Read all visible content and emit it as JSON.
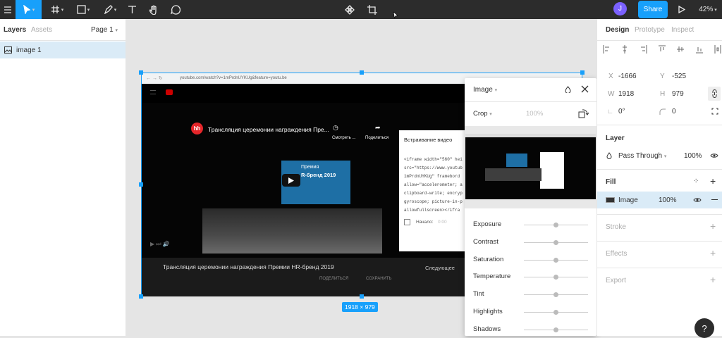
{
  "toolbar": {
    "avatar_initial": "J",
    "share_label": "Share",
    "zoom": "42%"
  },
  "left_panel": {
    "tab_layers": "Layers",
    "tab_assets": "Assets",
    "page_label": "Page 1",
    "layers": [
      {
        "label": "image 1"
      }
    ]
  },
  "canvas": {
    "dimension_badge": "1918 × 979",
    "browser_url": "youtube.com/watch?v=1mPrdnUYKUg&feature=youtu.be",
    "video": {
      "title": "Трансляция церемонии награждения Пре...",
      "watch_later": "Смотреть ...",
      "share": "Поделиться",
      "screen_line1": "Премия",
      "screen_line2": "R-бренд 2019",
      "below_title": "Трансляция церемонии награждения Премии HR-бренд 2019",
      "next_label": "Следующее",
      "share_action": "ПОДЕЛИТЬСЯ",
      "save_action": "СОХРАНИТЬ"
    },
    "embed": {
      "heading": "Встраивание видео",
      "code_lines": [
        "<iframe width=\"560\" hei",
        "src=\"https://www.youtub",
        "1mPrdnUYKUg\" framebord",
        "allow=\"accelerometer; a",
        "clipboard-write; encryp",
        "gyroscope; picture-in-p",
        "allowfullscreen></ifra"
      ],
      "start_label": "Начало:",
      "start_value": "0:00"
    }
  },
  "image_popover": {
    "title": "Image",
    "crop_label": "Crop",
    "crop_value": "100%",
    "adjustments": [
      {
        "label": "Exposure",
        "value": 0.5
      },
      {
        "label": "Contrast",
        "value": 0.5
      },
      {
        "label": "Saturation",
        "value": 0.5
      },
      {
        "label": "Temperature",
        "value": 0.5
      },
      {
        "label": "Tint",
        "value": 0.5
      },
      {
        "label": "Highlights",
        "value": 0.5
      },
      {
        "label": "Shadows",
        "value": 0.5
      }
    ]
  },
  "right_panel": {
    "tab_design": "Design",
    "tab_prototype": "Prototype",
    "tab_inspect": "Inspect",
    "x_label": "X",
    "x_value": "-1666",
    "y_label": "Y",
    "y_value": "-525",
    "w_label": "W",
    "w_value": "1918",
    "h_label": "H",
    "h_value": "979",
    "rotation": "0°",
    "corner_radius": "0",
    "layer_heading": "Layer",
    "blend_mode": "Pass Through",
    "layer_opacity": "100%",
    "fill_heading": "Fill",
    "fill_type": "Image",
    "fill_opacity": "100%",
    "stroke_heading": "Stroke",
    "effects_heading": "Effects",
    "export_heading": "Export"
  },
  "help_label": "?"
}
